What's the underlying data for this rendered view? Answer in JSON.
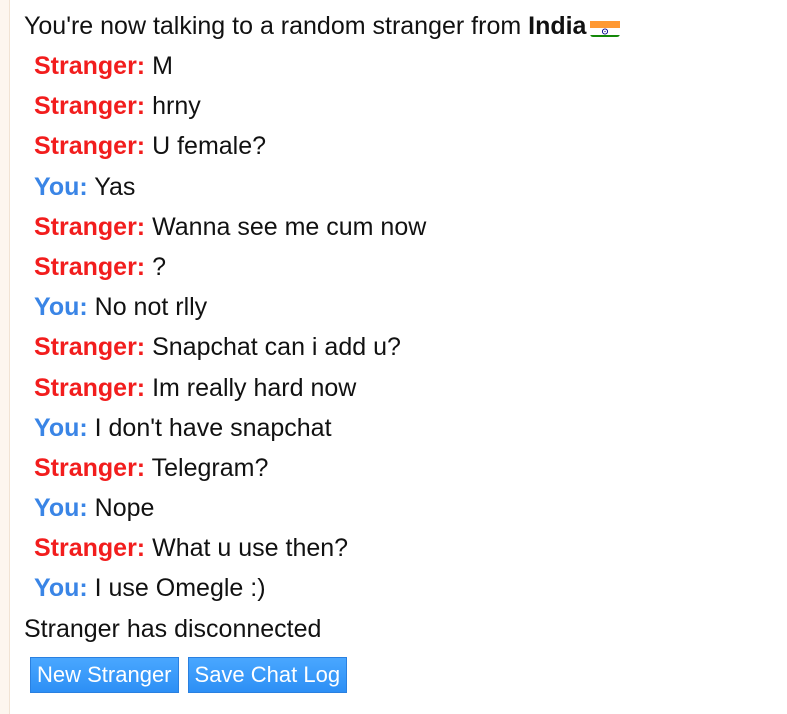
{
  "status_connected": {
    "prefix": "You're now talking to a random stranger from ",
    "country": "India",
    "flag_icon": "india-flag-icon"
  },
  "messages": [
    {
      "sender": "Stranger:",
      "text": "M",
      "role": "stranger"
    },
    {
      "sender": "Stranger:",
      "text": "hrny",
      "role": "stranger"
    },
    {
      "sender": "Stranger:",
      "text": "U female?",
      "role": "stranger"
    },
    {
      "sender": "You:",
      "text": "Yas",
      "role": "you"
    },
    {
      "sender": "Stranger:",
      "text": "Wanna see me cum now",
      "role": "stranger"
    },
    {
      "sender": "Stranger:",
      "text": "?",
      "role": "stranger"
    },
    {
      "sender": "You:",
      "text": "No not rlly",
      "role": "you"
    },
    {
      "sender": "Stranger:",
      "text": "Snapchat can i add u?",
      "role": "stranger"
    },
    {
      "sender": "Stranger:",
      "text": "Im really hard now",
      "role": "stranger"
    },
    {
      "sender": "You:",
      "text": "I don't have snapchat",
      "role": "you"
    },
    {
      "sender": "Stranger:",
      "text": "Telegram?",
      "role": "stranger"
    },
    {
      "sender": "You:",
      "text": "Nope",
      "role": "you"
    },
    {
      "sender": "Stranger:",
      "text": "What u use then?",
      "role": "stranger"
    },
    {
      "sender": "You:",
      "text": "I use Omegle :)",
      "role": "you"
    }
  ],
  "status_disconnected": "Stranger has disconnected",
  "buttons": {
    "new_stranger": "New Stranger",
    "save_chat_log": "Save Chat Log"
  },
  "colors": {
    "stranger": "#f21d1d",
    "you": "#3a85e6",
    "button": "#3a96f7"
  }
}
